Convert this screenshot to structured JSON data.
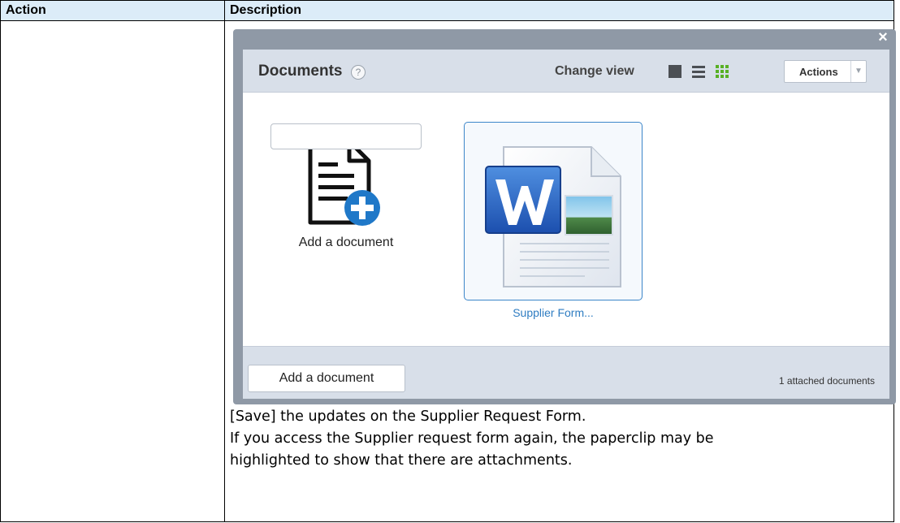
{
  "table": {
    "headers": {
      "action": "Action",
      "description": "Description"
    },
    "row": {
      "action_text": "",
      "dialog": {
        "close_symbol": "×",
        "title": "Documents",
        "help_symbol": "?",
        "change_view_label": "Change view",
        "view_buttons": [
          "large-icons",
          "list",
          "grid"
        ],
        "actions_label": "Actions",
        "actions_caret": "▼",
        "name_input": {
          "value": "",
          "placeholder": ""
        },
        "add_tile_label": "Add a document",
        "files": [
          {
            "name": "Supplier Form...",
            "type": "word-document",
            "selected": true
          }
        ],
        "footer_add_label": "Add a document",
        "attached_count_text": "1 attached documents"
      },
      "description_lines": [
        "[Save] the updates on the Supplier Request Form.",
        "If you access the Supplier request form again, the paperclip may be",
        "highlighted to show that there are attachments."
      ]
    }
  },
  "colors": {
    "header_bg": "#dcecf8",
    "dialog_frame": "#8f99a6",
    "panel_header": "#d8dfe9",
    "selection_border": "#3c86c9",
    "link_blue": "#2f7dc2",
    "grid_view_green": "#58b025",
    "add_badge_blue": "#1f78c8"
  }
}
